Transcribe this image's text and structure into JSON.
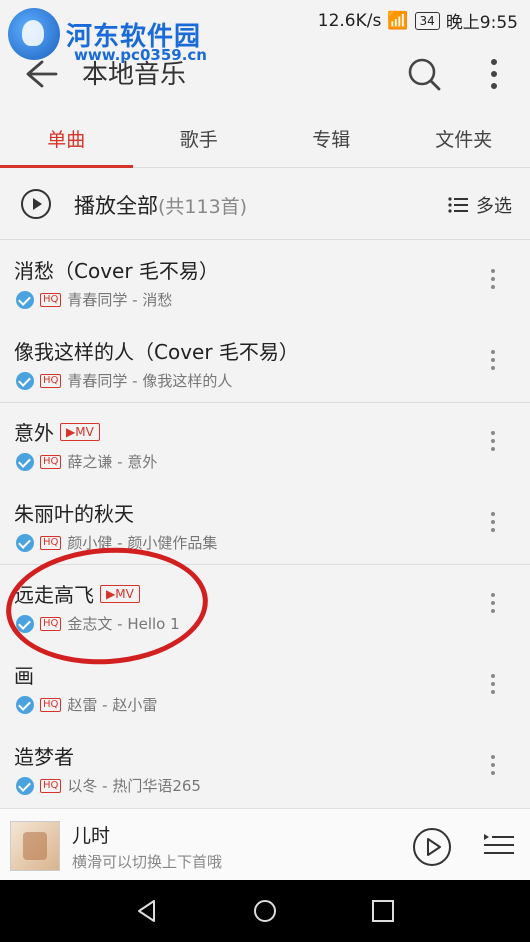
{
  "status_bar": {
    "speed": "12.6K/s",
    "battery": "34",
    "time": "晚上9:55"
  },
  "watermark": {
    "title": "河东软件园",
    "url": "www.pc0359.cn"
  },
  "app_bar": {
    "title": "本地音乐"
  },
  "tabs": [
    {
      "label": "单曲",
      "active": true
    },
    {
      "label": "歌手",
      "active": false
    },
    {
      "label": "专辑",
      "active": false
    },
    {
      "label": "文件夹",
      "active": false
    }
  ],
  "play_all": {
    "label": "播放全部",
    "count": "(共113首)",
    "multi_select": "多选"
  },
  "songs": [
    {
      "title": "消愁（Cover 毛不易）",
      "mv": "",
      "sub": "青春同学 - 消愁",
      "divider": false
    },
    {
      "title": "像我这样的人（Cover 毛不易）",
      "mv": "",
      "sub": "青春同学 - 像我这样的人",
      "divider": true
    },
    {
      "title": "意外",
      "mv": "MV",
      "sub": "薛之谦 - 意外",
      "divider": false
    },
    {
      "title": "朱丽叶的秋天",
      "mv": "",
      "sub": "颜小健 - 颜小健作品集",
      "divider": true
    },
    {
      "title": "远走高飞",
      "mv": "MV",
      "sub": "金志文 - Hello 1",
      "divider": false
    },
    {
      "title": "画",
      "mv": "",
      "sub": "赵雷 - 赵小雷",
      "divider": false
    },
    {
      "title": "造梦者",
      "mv": "",
      "sub": "以冬 - 热门华语265",
      "divider": false
    }
  ],
  "hq_label": "HQ",
  "mv_prefix": "▶",
  "now_playing": {
    "title": "儿时",
    "subtitle": "横滑可以切换上下首哦"
  },
  "colors": {
    "accent": "#d6332a",
    "check": "#4aa3df",
    "annotation_circle": "#d21f1f"
  }
}
